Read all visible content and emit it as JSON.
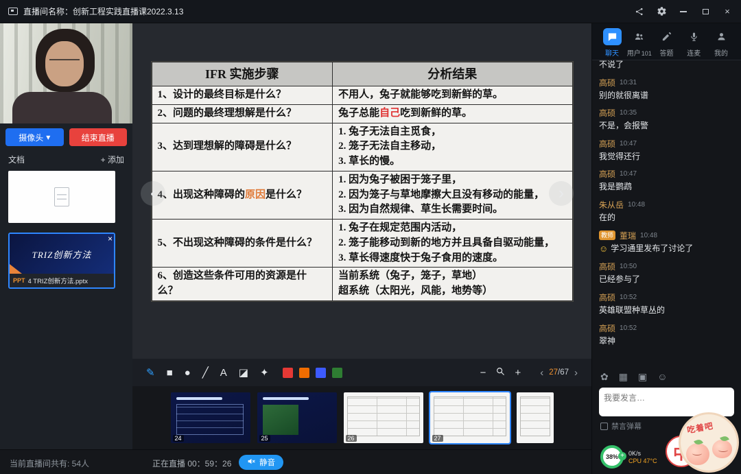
{
  "theme": {
    "accent": "#2e90ff",
    "danger": "#e8423d",
    "name_color": "#d8a355",
    "badge_bg": "#e0952f",
    "green": "#35c06a",
    "cpu_color": "#f5a623"
  },
  "titlebar": {
    "title": "直播间名称：创新工程实践直播课2022.3.13"
  },
  "left": {
    "camera_btn": "摄像头",
    "camera_dropdown": "▾",
    "end_btn": "结束直播",
    "docs_label": "文档",
    "add_btn": "+ 添加",
    "ppt": {
      "badge": "PPT",
      "filename": "4 TRIZ创新方法.pptx",
      "cover": "TRIZ创新方法",
      "close": "×"
    }
  },
  "stage": {
    "table": {
      "col1": "IFR 实施步骤",
      "col2": "分析结果",
      "rows": [
        {
          "q": [
            {
              "t": "1、设计的最终目标是什么？"
            }
          ],
          "a": [
            [
              {
                "t": "不用人，兔子就能够吃到新鲜的草。"
              }
            ]
          ]
        },
        {
          "q": [
            {
              "t": "2、问题的最终理想解是什么？"
            }
          ],
          "a": [
            [
              {
                "t": "兔子总能"
              },
              {
                "t": "自己",
                "c": "#e03131"
              },
              {
                "t": "吃到新鲜的草。"
              }
            ]
          ]
        },
        {
          "q": [
            {
              "t": "3、达到理想解的障碍是什么？"
            }
          ],
          "a": [
            [
              {
                "t": "1. 兔子无法自主觅食，"
              }
            ],
            [
              {
                "t": "2. 笼子无法自主移动，"
              }
            ],
            [
              {
                "t": "3. 草长的慢。"
              }
            ]
          ]
        },
        {
          "q": [
            {
              "t": "4、出现这种障碍的"
            },
            {
              "t": "原因",
              "c": "#e07b3a"
            },
            {
              "t": "是什么？"
            }
          ],
          "a": [
            [
              {
                "t": "1. 因为兔子被困于笼子里，"
              }
            ],
            [
              {
                "t": "2. 因为笼子与草地摩擦大且没有移动的能量，"
              }
            ],
            [
              {
                "t": "3. 因为自然规律、草生长需要时间。"
              }
            ]
          ]
        },
        {
          "q": [
            {
              "t": "5、不出现这种障碍的条件是什么？"
            }
          ],
          "a": [
            [
              {
                "t": "1. 兔子在规定范围内活动，"
              }
            ],
            [
              {
                "t": "2. 笼子能移动到新的地方并且具备自驱动能量，"
              }
            ],
            [
              {
                "t": "3. 草长得速度快于兔子食用的速度。"
              }
            ]
          ]
        },
        {
          "q": [
            {
              "t": "6、创造这些条件可用的资源是什么？"
            }
          ],
          "a": [
            [
              {
                "t": "当前系统（兔子，笼子，草地）"
              }
            ],
            [
              {
                "t": "超系统（太阳光，风能，地势等）"
              }
            ]
          ]
        }
      ]
    },
    "nav": {
      "prev": "‹",
      "next": "›"
    },
    "tools": [
      {
        "key": "pen",
        "glyph": "✎",
        "active": true
      },
      {
        "key": "rect",
        "glyph": "■"
      },
      {
        "key": "ellipse",
        "glyph": "●"
      },
      {
        "key": "line",
        "glyph": "╱"
      },
      {
        "key": "text",
        "glyph": "A"
      },
      {
        "key": "eraser",
        "glyph": "◪"
      },
      {
        "key": "marker",
        "glyph": "✦"
      }
    ],
    "colors": [
      "#e53935",
      "#ef6c00",
      "#3d5afe",
      "#2e7d32"
    ],
    "zoom": {
      "minus": "−",
      "plus": "+"
    },
    "pager": {
      "prev": "‹",
      "current": "27",
      "sep": "/",
      "total": "67",
      "next": "›"
    },
    "thumbnails": [
      {
        "num": "24",
        "style": "navy",
        "variant": "table"
      },
      {
        "num": "25",
        "style": "navy",
        "variant": "photo"
      },
      {
        "num": "26",
        "style": "white"
      },
      {
        "num": "27",
        "style": "white",
        "active": true
      },
      {
        "num": "",
        "style": "white",
        "partial": true
      }
    ]
  },
  "bottombar": {
    "viewers": "当前直播间共有: 54人",
    "live": "正在直播 00：59：26",
    "mute": "静音"
  },
  "chat": {
    "tabs": [
      {
        "key": "chat",
        "label": "聊天",
        "active": true
      },
      {
        "key": "users",
        "label": "用户",
        "count": "101"
      },
      {
        "key": "answer",
        "label": "答题"
      },
      {
        "key": "mic",
        "label": "连麦"
      },
      {
        "key": "mine",
        "label": "我的"
      }
    ],
    "messages": [
      {
        "text": "不说了",
        "partial": true
      },
      {
        "name": "高硕",
        "time": "10:31",
        "text": "别的就很离谱"
      },
      {
        "name": "高硕",
        "time": "10:35",
        "text": "不是，会报警"
      },
      {
        "name": "高硕",
        "time": "10:47",
        "text": "我觉得还行"
      },
      {
        "name": "高硕",
        "time": "10:47",
        "text": "我是鹦鹉"
      },
      {
        "name": "朱从岳",
        "time": "10:48",
        "text": "在的"
      },
      {
        "badge": "教师",
        "name": "董瑞",
        "time": "10:48",
        "emoji": "☺",
        "text": "学习通里发布了讨论了"
      },
      {
        "name": "高硕",
        "time": "10:50",
        "text": "已经参与了"
      },
      {
        "name": "高硕",
        "time": "10:52",
        "text": "英雄联盟种草丛的"
      },
      {
        "name": "高硕",
        "time": "10:52",
        "text": "翠神"
      }
    ],
    "tool_icons": [
      {
        "key": "sticker",
        "glyph": "✿"
      },
      {
        "key": "poll",
        "glyph": "▦"
      },
      {
        "key": "image",
        "glyph": "▣"
      },
      {
        "key": "emoji",
        "glyph": "☺"
      }
    ],
    "input_placeholder": "我要发言…",
    "mute_danmu": "禁言弹幕"
  },
  "widgets": {
    "perf": "38%",
    "perf_plus": "+",
    "net": "0K/s",
    "cpu": "CPU 47°C",
    "mascot": "吃着吧",
    "watermark": "中"
  }
}
